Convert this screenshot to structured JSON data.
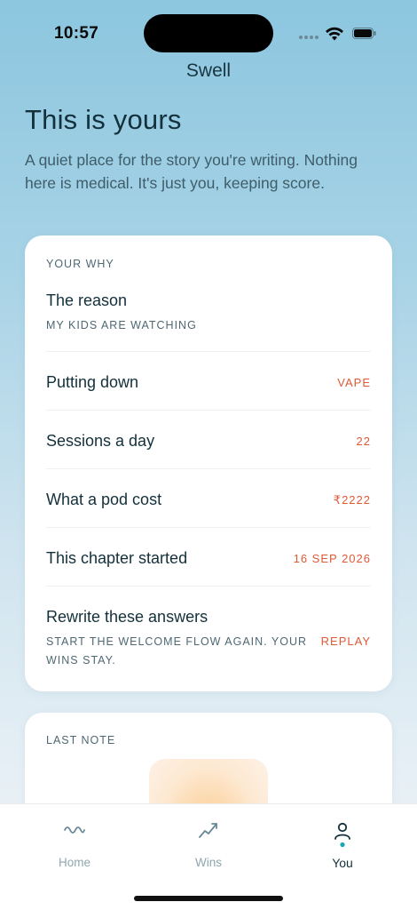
{
  "status_bar": {
    "time": "10:57"
  },
  "app": {
    "title": "Swell"
  },
  "page": {
    "title": "This is yours",
    "subtitle": "A quiet place for the story you're writing. Nothing here is medical. It's just you, keeping score."
  },
  "why_card": {
    "section_label": "YOUR WHY",
    "reason": {
      "label": "The reason",
      "value": "MY KIDS ARE WATCHING"
    },
    "rows": [
      {
        "label": "Putting down",
        "value": "VAPE"
      },
      {
        "label": "Sessions a day",
        "value": "22"
      },
      {
        "label": "What a pod cost",
        "value": "₹2222"
      },
      {
        "label": "This chapter started",
        "value": "16 SEP 2026"
      }
    ],
    "rewrite": {
      "label": "Rewrite these answers",
      "sub": "START THE WELCOME FLOW AGAIN. YOUR WINS STAY.",
      "action": "REPLAY"
    }
  },
  "note_card": {
    "section_label": "LAST NOTE"
  },
  "tabs": [
    {
      "label": "Home",
      "icon": "wave-icon"
    },
    {
      "label": "Wins",
      "icon": "trend-icon"
    },
    {
      "label": "You",
      "icon": "person-icon",
      "active": true
    }
  ],
  "colors": {
    "accent": "#dd5a37",
    "active_dot": "#1aa6b3",
    "text": "#13303b",
    "muted": "#8fa6b0"
  }
}
